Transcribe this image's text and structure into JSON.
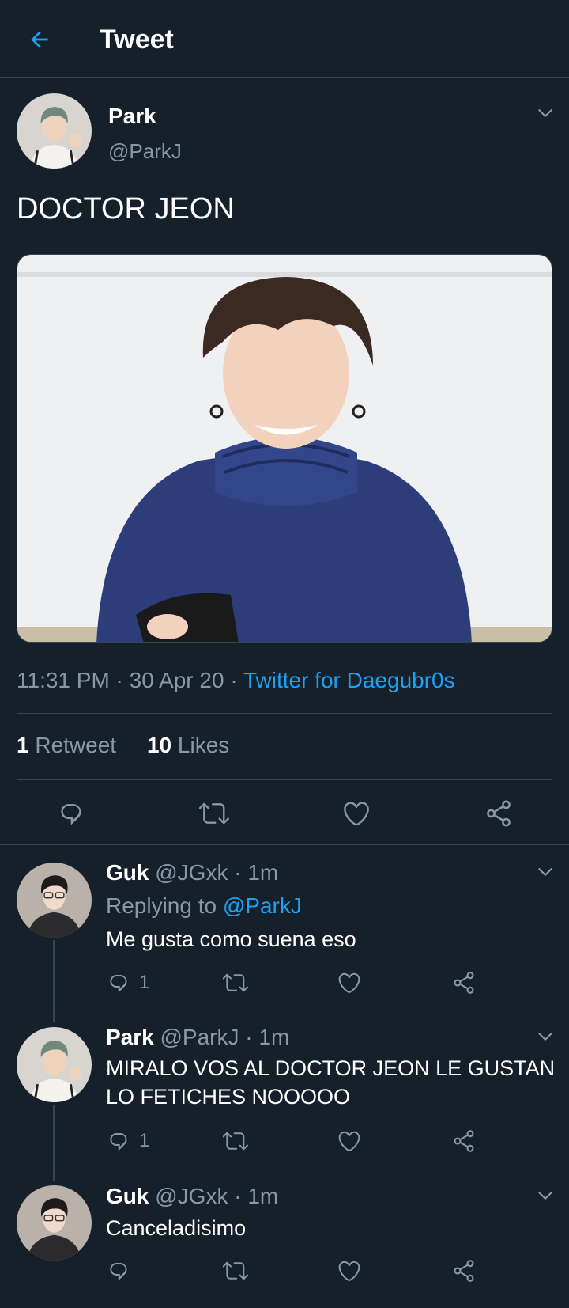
{
  "header": {
    "title": "Tweet",
    "back_icon": "arrow-left-icon"
  },
  "tweet": {
    "name": "Park",
    "handle": "@ParkJ",
    "text": "DOCTOR JEON",
    "time": "11:31 PM",
    "date": "30 Apr 20",
    "separator": " · ",
    "source": "Twitter for Daegubr0s",
    "retweet_count": "1",
    "retweet_label": "Retweet",
    "like_count": "10",
    "like_label": "Likes"
  },
  "replies": [
    {
      "name": "Guk",
      "handle": "@JGxk",
      "time": "1m",
      "replying_prefix": "Replying to ",
      "replying_to": "@ParkJ",
      "text": "Me gusta como suena eso",
      "reply_count": "1"
    },
    {
      "name": "Park",
      "handle": "@ParkJ",
      "time": "1m",
      "text": "MIRALO VOS AL DOCTOR JEON LE GUSTAN LO FETICHES NOOOOO",
      "reply_count": "1"
    },
    {
      "name": "Guk",
      "handle": "@JGxk",
      "time": "1m",
      "text": "Canceladisimo",
      "reply_count": ""
    }
  ],
  "colors": {
    "background": "#15202b",
    "accent": "#1da1f2",
    "muted": "#8899a6",
    "border": "#38444d"
  }
}
